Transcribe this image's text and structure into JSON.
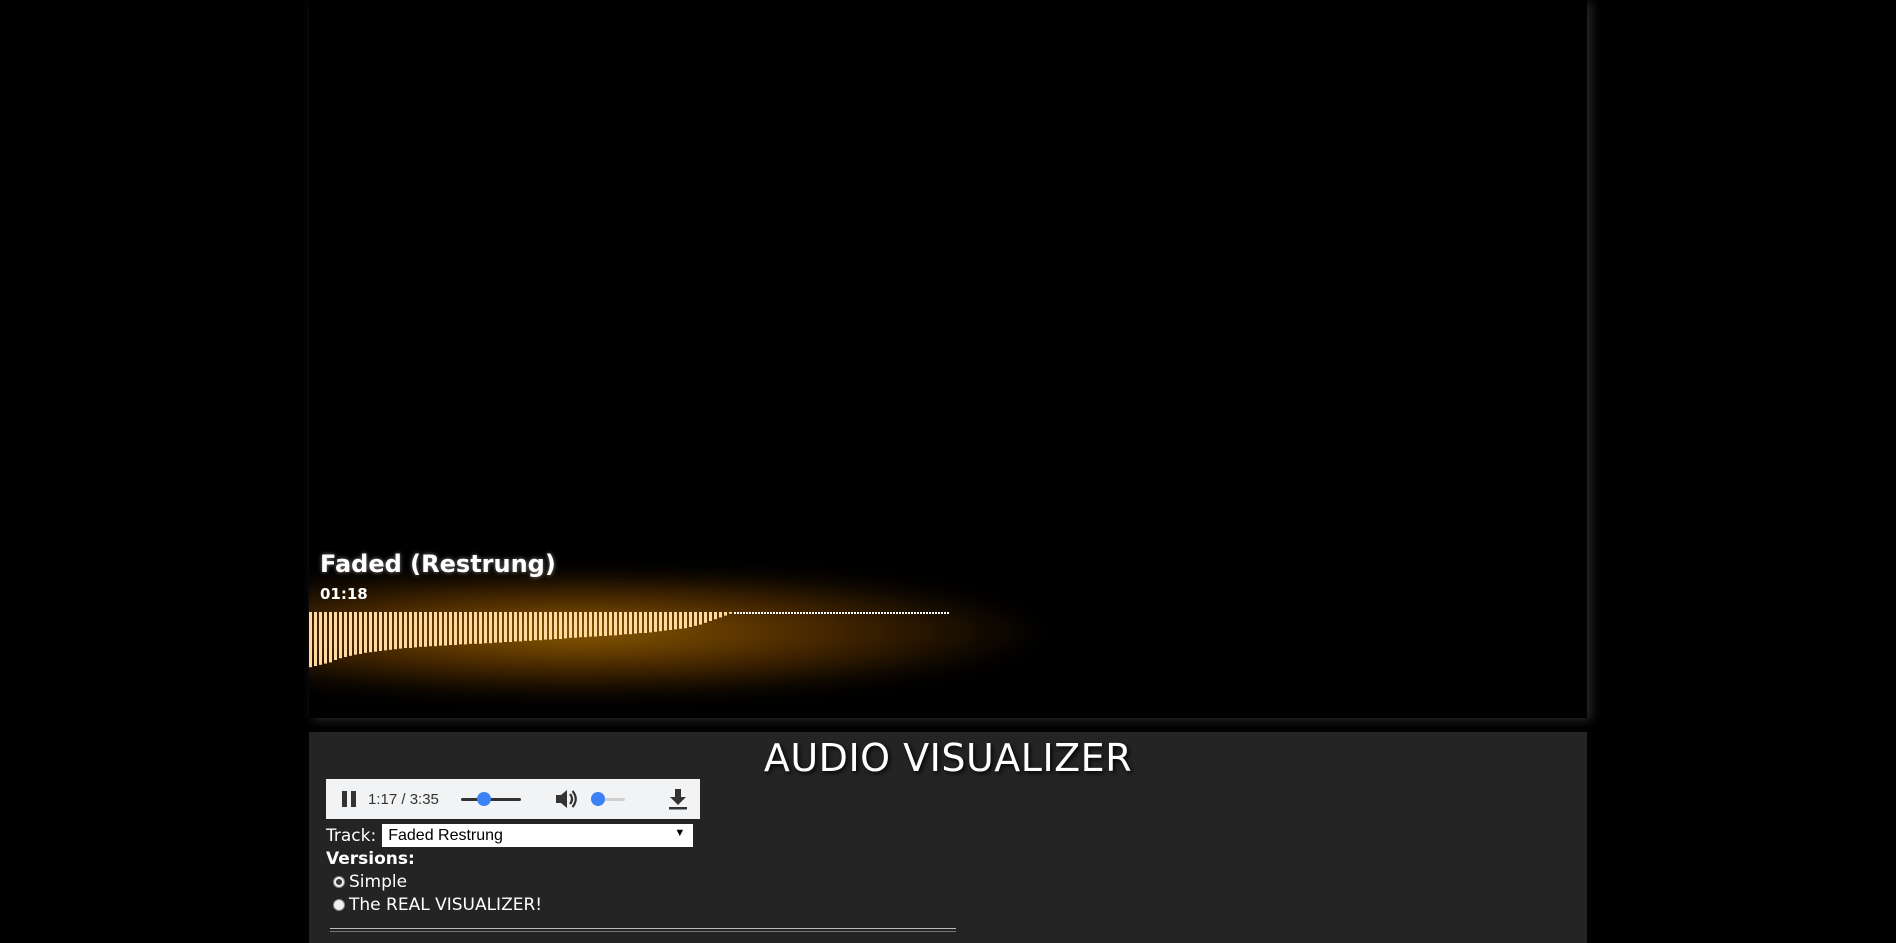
{
  "visualizer": {
    "track_title": "Faded (Restrung)",
    "elapsed": "01:18",
    "bar_color": "#ffd9a0",
    "glow_color": "#ffa500",
    "bars": [
      0.92,
      0.9,
      0.88,
      0.86,
      0.84,
      0.8,
      0.77,
      0.75,
      0.73,
      0.71,
      0.7,
      0.68,
      0.67,
      0.66,
      0.65,
      0.64,
      0.63,
      0.62,
      0.61,
      0.6,
      0.6,
      0.59,
      0.58,
      0.58,
      0.57,
      0.57,
      0.56,
      0.56,
      0.55,
      0.55,
      0.54,
      0.54,
      0.53,
      0.53,
      0.53,
      0.52,
      0.52,
      0.51,
      0.51,
      0.5,
      0.5,
      0.49,
      0.49,
      0.48,
      0.48,
      0.47,
      0.47,
      0.46,
      0.46,
      0.45,
      0.45,
      0.44,
      0.43,
      0.43,
      0.42,
      0.42,
      0.41,
      0.41,
      0.4,
      0.4,
      0.39,
      0.39,
      0.38,
      0.37,
      0.37,
      0.36,
      0.35,
      0.35,
      0.34,
      0.33,
      0.32,
      0.31,
      0.3,
      0.29,
      0.28,
      0.27,
      0.25,
      0.23,
      0.21,
      0.18,
      0.15,
      0.12,
      0.09,
      0.06,
      0.03
    ]
  },
  "panel": {
    "title": "AUDIO VISUALIZER"
  },
  "player": {
    "time": "1:17 / 3:35",
    "progress": 0.36,
    "volume": 0.0,
    "accent": "#3b82f6"
  },
  "track": {
    "label": "Track:",
    "selected": "Faded Restrung"
  },
  "versions": {
    "label": "Versions:",
    "options": [
      "Simple",
      "The REAL VISUALIZER!"
    ],
    "selected": "Simple"
  }
}
